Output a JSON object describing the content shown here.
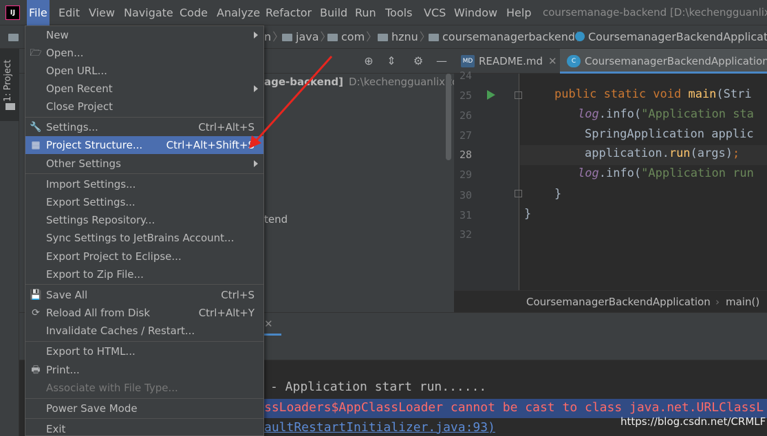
{
  "menubar": {
    "items": [
      "File",
      "Edit",
      "View",
      "Navigate",
      "Code",
      "Analyze",
      "Refactor",
      "Build",
      "Run",
      "Tools",
      "VCS",
      "Window",
      "Help"
    ],
    "window_title": "coursemanage-backend [D:\\kechengguanlixit"
  },
  "navbar": {
    "crumbs": [
      "n",
      "java",
      "com",
      "hznu",
      "coursemanagerbackend",
      "CoursemanagerBackendApplication"
    ]
  },
  "left_stripe": {
    "project_tab": "1: Project"
  },
  "project_tree": {
    "root_label": "age-backend]",
    "root_path": "D:\\kechengguanlixiton",
    "item_label": "tend"
  },
  "editor": {
    "tabs": [
      "README.md",
      "CoursemanagerBackendApplication.j"
    ],
    "line_numbers": [
      "24",
      "25",
      "26",
      "27",
      "28",
      "29",
      "30",
      "31",
      "32"
    ],
    "code": {
      "l25_kw": "public static void ",
      "l25_fn": "main",
      "l25_rest": "(Stri",
      "l26_log": "log",
      "l26_mid": ".info(",
      "l26_str": "\"Application sta",
      "l27": "SpringApplication applic",
      "l28_a": "application.",
      "l28_fn": "run",
      "l28_b": "(args)",
      "l28_c": ";",
      "l29_log": "log",
      "l29_mid": ".info(",
      "l29_str": "\"Application run",
      "l30": "}",
      "l31": "}"
    },
    "breadcrumb": [
      "CoursemanagerBackendApplication",
      "main()"
    ]
  },
  "console": {
    "line1": "- Application start run......",
    "line2": "ssLoaders$AppClassLoader cannot be cast to class java.net.URLClassL",
    "line3": "aultRestartInitializer.java:93)",
    "line3_close": ")"
  },
  "watermark": "https://blog.csdn.net/CRMLF",
  "file_menu": {
    "new": "New",
    "open": "Open...",
    "open_url": "Open URL...",
    "open_recent": "Open Recent",
    "close_project": "Close Project",
    "settings": "Settings...",
    "settings_short": "Ctrl+Alt+S",
    "project_structure": "Project Structure...",
    "project_structure_short": "Ctrl+Alt+Shift+S",
    "other_settings": "Other Settings",
    "import_settings": "Import Settings...",
    "export_settings": "Export Settings...",
    "settings_repository": "Settings Repository...",
    "sync_settings": "Sync Settings to JetBrains Account...",
    "export_eclipse": "Export Project to Eclipse...",
    "export_zip": "Export to Zip File...",
    "save_all": "Save All",
    "save_all_short": "Ctrl+S",
    "reload_all": "Reload All from Disk",
    "reload_all_short": "Ctrl+Alt+Y",
    "invalidate_caches": "Invalidate Caches / Restart...",
    "export_html": "Export to HTML...",
    "print": "Print...",
    "associate": "Associate with File Type...",
    "power_save": "Power Save Mode",
    "exit": "Exit"
  },
  "colors": {
    "selection": "#4b6eaf",
    "annotation_arrow": "#e8261f",
    "error_text": "#ff6b68",
    "error_highlight": "#314b84"
  }
}
